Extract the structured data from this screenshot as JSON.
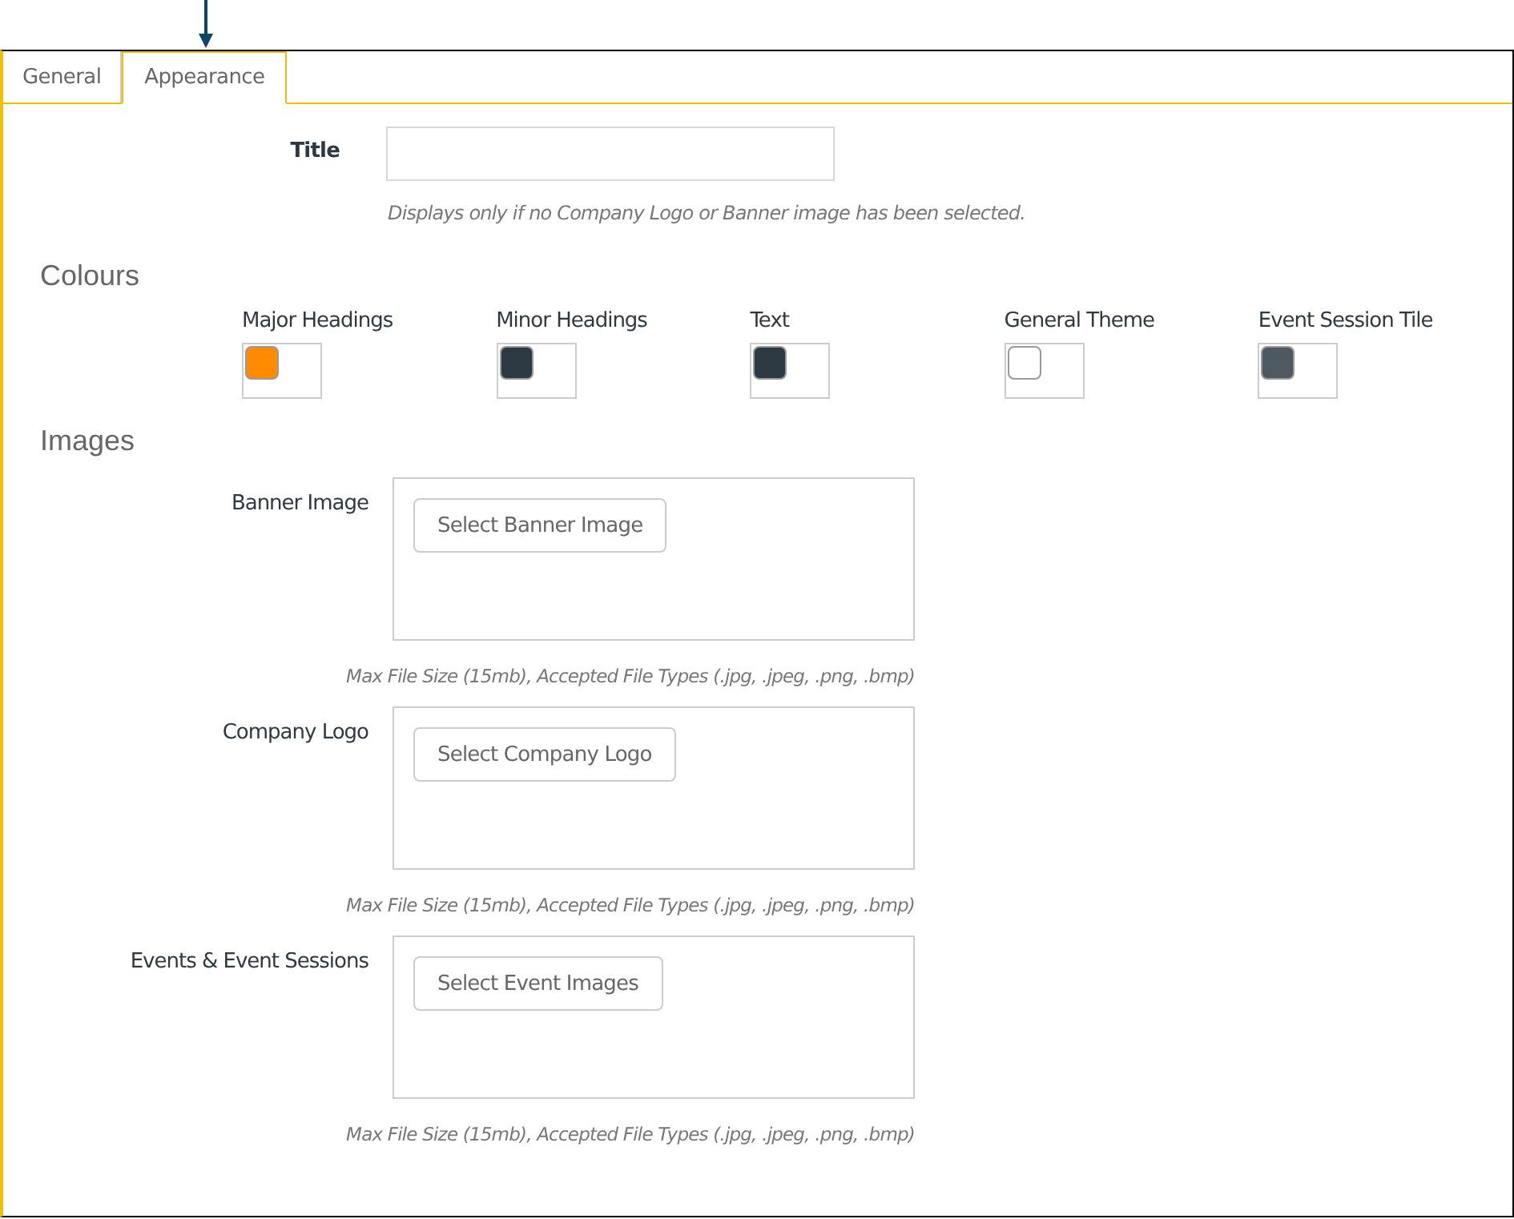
{
  "tabs": [
    {
      "label": "General",
      "selected": false
    },
    {
      "label": "Appearance",
      "selected": true
    }
  ],
  "title_field": {
    "label": "Title",
    "hint": "Displays only if no Company Logo or Banner image has been selected."
  },
  "colours": {
    "heading": "Colours",
    "items": [
      {
        "label": "Major Headings",
        "color": "#ff8c00"
      },
      {
        "label": "Minor Headings",
        "color": "#2d3943"
      },
      {
        "label": "Text",
        "color": "#2d3943"
      },
      {
        "label": "General Theme",
        "color": "#ffffff"
      },
      {
        "label": "Event Session Tile",
        "color": "#4f5961"
      }
    ]
  },
  "images": {
    "heading": "Images",
    "items": [
      {
        "label": "Banner Image",
        "button": "Select Banner Image",
        "hint": "Max File Size (15mb), Accepted File Types (.jpg, .jpeg, .png, .bmp)"
      },
      {
        "label": "Company Logo",
        "button": "Select Company Logo",
        "hint": "Max File Size (15mb), Accepted File Types (.jpg, .jpeg, .png, .bmp)"
      },
      {
        "label": "Events & Event Sessions",
        "button": "Select Event Images",
        "hint": "Max File Size (15mb), Accepted File Types (.jpg, .jpeg, .png, .bmp)"
      }
    ]
  }
}
